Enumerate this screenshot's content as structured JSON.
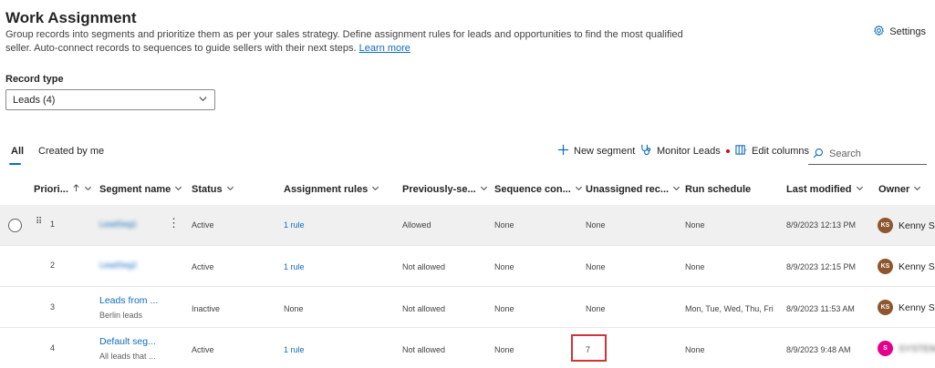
{
  "header": {
    "title": "Work Assignment",
    "description": "Group records into segments and prioritize them as per your sales strategy. Define assignment rules for leads and opportunities to find the most qualified seller. Auto-connect records to sequences to guide sellers with their next steps.",
    "learn_more": "Learn more",
    "settings_label": "Settings"
  },
  "record_type": {
    "label": "Record type",
    "value": "Leads (4)"
  },
  "tabs": [
    {
      "label": "All",
      "active": true
    },
    {
      "label": "Created by me",
      "active": false
    }
  ],
  "toolbar": {
    "new_segment": "New segment",
    "monitor_leads": "Monitor Leads",
    "edit_columns": "Edit columns",
    "search_placeholder": "Search"
  },
  "columns": [
    {
      "label": "Priori..."
    },
    {
      "label": "Segment name"
    },
    {
      "label": "Status"
    },
    {
      "label": "Assignment rules"
    },
    {
      "label": "Previously-se..."
    },
    {
      "label": "Sequence con..."
    },
    {
      "label": "Unassigned rec..."
    },
    {
      "label": "Run schedule"
    },
    {
      "label": "Last modified"
    },
    {
      "label": "Owner"
    }
  ],
  "rows": [
    {
      "priority": "1",
      "segment": "LeadSeg1",
      "segment_sub": "",
      "status": "Active",
      "rules": "1 rule",
      "previously": "Allowed",
      "sequence": "None",
      "unassigned": "None",
      "schedule": "None",
      "modified": "8/9/2023 12:13 PM",
      "owner_initials": "KS",
      "owner_name": "Kenny S",
      "owner_color": "#8e562e"
    },
    {
      "priority": "2",
      "segment": "LeadSeg2",
      "segment_sub": "",
      "status": "Active",
      "rules": "1 rule",
      "previously": "Not allowed",
      "sequence": "None",
      "unassigned": "None",
      "schedule": "None",
      "modified": "8/9/2023 12:15 PM",
      "owner_initials": "KS",
      "owner_name": "Kenny S",
      "owner_color": "#8e562e"
    },
    {
      "priority": "3",
      "segment": "Leads from ...",
      "segment_sub": "Berlin leads",
      "status": "Inactive",
      "rules": "None",
      "previously": "Not allowed",
      "sequence": "None",
      "unassigned": "None",
      "schedule": "Mon, Tue, Wed, Thu, Fri",
      "modified": "8/9/2023 11:53 AM",
      "owner_initials": "KS",
      "owner_name": "Kenny S",
      "owner_color": "#8e562e"
    },
    {
      "priority": "4",
      "segment": "Default seg...",
      "segment_sub": "All leads that ...",
      "status": "Active",
      "rules": "1 rule",
      "previously": "Not allowed",
      "sequence": "None",
      "unassigned": "7",
      "schedule": "None",
      "modified": "8/9/2023 9:48 AM",
      "owner_initials": "S",
      "owner_name": "SYSTEM",
      "owner_color": "#e3008c"
    }
  ]
}
